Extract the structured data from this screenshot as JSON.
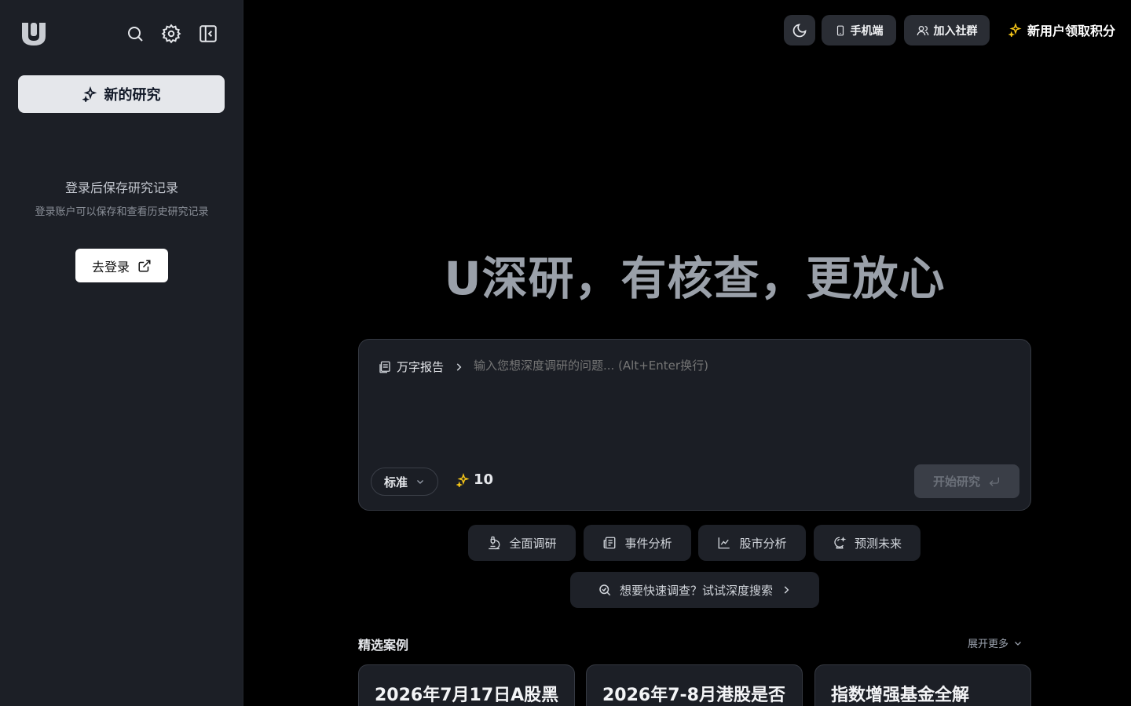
{
  "sidebar": {
    "logo_icon": "u-logo-icon",
    "search_icon": "search-icon",
    "settings_icon": "gear-icon",
    "collapse_icon": "collapse-sidebar-icon",
    "new_research_label": "新的研究",
    "empty_title": "登录后保存研究记录",
    "empty_subtitle": "登录账户可以保存和查看历史研究记录",
    "login_label": "去登录"
  },
  "topbar": {
    "theme_icon": "moon-icon",
    "mobile_label": "手机端",
    "community_label": "加入社群",
    "promo_label": "新用户领取积分"
  },
  "hero": {
    "title": "U深研，有核查，更放心"
  },
  "composer": {
    "mode_label": "万字报告",
    "placeholder": "输入您想深度调研的问题... (Alt+Enter换行)",
    "level_value": "标准",
    "credits": "10",
    "start_label": "开始研究"
  },
  "quick_actions": [
    {
      "label": "全面调研",
      "icon": "microscope-icon"
    },
    {
      "label": "事件分析",
      "icon": "newspaper-icon"
    },
    {
      "label": "股市分析",
      "icon": "line-chart-icon"
    },
    {
      "label": "预测未来",
      "icon": "crystal-ball-icon"
    }
  ],
  "deep_search_label": "想要快速调查？试试深度搜索",
  "featured": {
    "title": "精选案例",
    "expand_label": "展开更多",
    "cases": [
      {
        "title": "2026年7月17日A股黑"
      },
      {
        "title": "2026年7-8月港股是否"
      },
      {
        "title": "指数增强基金全解"
      }
    ]
  },
  "colors": {
    "background": "#000000",
    "sidebar": "#1c1f26",
    "accent_gold": "#f5c518"
  }
}
